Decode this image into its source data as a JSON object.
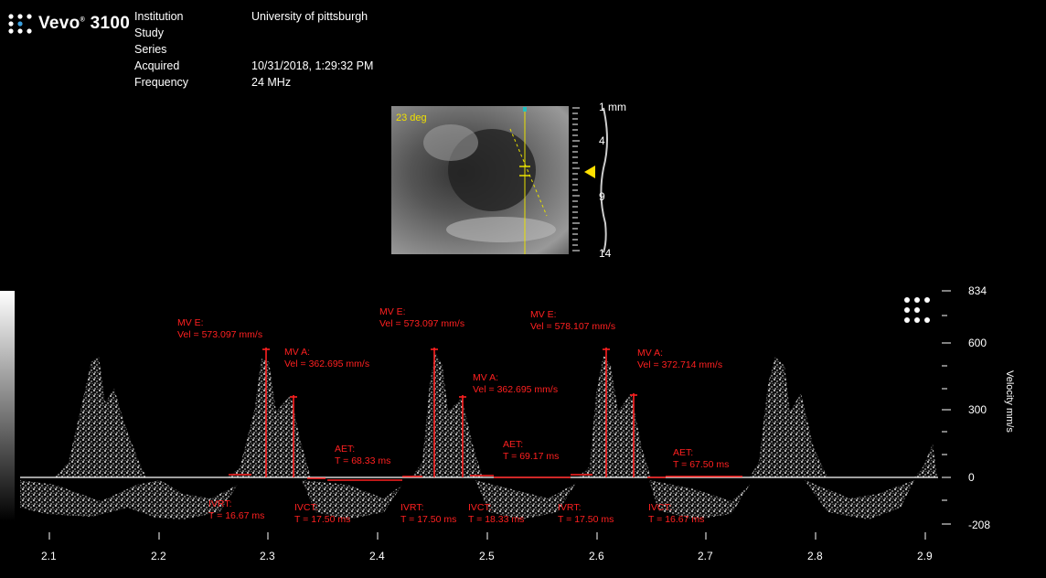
{
  "header": {
    "brand": "Vevo",
    "model": "3100",
    "fields": [
      {
        "label": "Institution",
        "value": "University of pittsburgh"
      },
      {
        "label": "Study",
        "value": ""
      },
      {
        "label": "Series",
        "value": ""
      },
      {
        "label": "Acquired",
        "value": "10/31/2018, 1:29:32 PM"
      },
      {
        "label": "Frequency",
        "value": "24 MHz"
      }
    ]
  },
  "bmode": {
    "angle_label": "23 deg",
    "depth_labels": [
      "1 mm",
      "4",
      "9",
      "14"
    ]
  },
  "doppler": {
    "y_axis_title": "Velocity mm/s",
    "y_ticks": [
      "834",
      "600",
      "300",
      "0",
      "-208"
    ],
    "x_ticks": [
      "2.1",
      "2.2",
      "2.3",
      "2.4",
      "2.5",
      "2.6",
      "2.7",
      "2.8",
      "2.9"
    ]
  },
  "annotations": {
    "mve1": {
      "l1": "MV E:",
      "l2": "Vel = 573.097 mm/s"
    },
    "mve2": {
      "l1": "MV E:",
      "l2": "Vel = 573.097 mm/s"
    },
    "mve3": {
      "l1": "MV E:",
      "l2": "Vel = 578.107 mm/s"
    },
    "mva1": {
      "l1": "MV A:",
      "l2": "Vel = 362.695 mm/s"
    },
    "mva2": {
      "l1": "MV A:",
      "l2": "Vel = 362.695 mm/s"
    },
    "mva3": {
      "l1": "MV A:",
      "l2": "Vel = 372.714 mm/s"
    },
    "aet1": {
      "l1": "AET:",
      "l2": "T = 68.33 ms"
    },
    "aet2": {
      "l1": "AET:",
      "l2": "T = 69.17 ms"
    },
    "aet3": {
      "l1": "AET:",
      "l2": "T = 67.50 ms"
    },
    "ivrt1": {
      "l1": "IVRT:",
      "l2": "T = 16.67 ms"
    },
    "ivct1": {
      "l1": "IVCT:",
      "l2": "T = 17.50 ms"
    },
    "ivrt2": {
      "l1": "IVRT:",
      "l2": "T = 17.50 ms"
    },
    "ivct2": {
      "l1": "IVCT:",
      "l2": "T = 18.33 ms"
    },
    "ivrt3": {
      "l1": "IVRT:",
      "l2": "T = 17.50 ms"
    },
    "ivct3": {
      "l1": "IVCT:",
      "l2": "T = 16.67 ms"
    }
  },
  "colors": {
    "annotation": "#ff2020",
    "angle": "#f0e000",
    "baseline": "#ffffff"
  }
}
